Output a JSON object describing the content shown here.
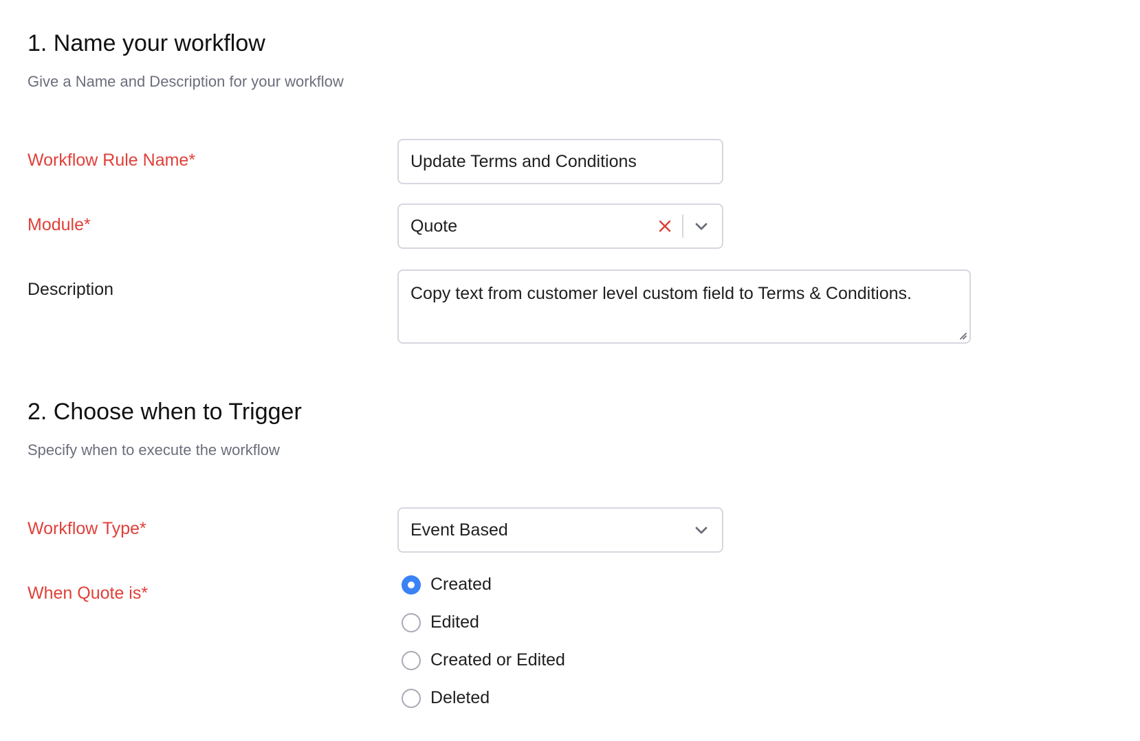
{
  "section1": {
    "title": "1. Name your workflow",
    "subtitle": "Give a Name and Description for your workflow"
  },
  "fields": {
    "rule_name": {
      "label": "Workflow Rule Name*",
      "value": "Update Terms and Conditions"
    },
    "module": {
      "label": "Module*",
      "value": "Quote"
    },
    "description": {
      "label": "Description",
      "value": "Copy text from customer level custom field to Terms & Conditions."
    }
  },
  "section2": {
    "title": "2. Choose when to Trigger",
    "subtitle": "Specify when to execute the workflow"
  },
  "trigger": {
    "workflow_type": {
      "label": "Workflow Type*",
      "value": "Event Based"
    },
    "when": {
      "label": "When Quote is*",
      "options": [
        {
          "label": "Created",
          "selected": true
        },
        {
          "label": "Edited",
          "selected": false
        },
        {
          "label": "Created or Edited",
          "selected": false
        },
        {
          "label": "Deleted",
          "selected": false
        }
      ]
    }
  },
  "colors": {
    "required_label": "#e0403a",
    "radio_selected": "#3b82f6",
    "clear_icon": "#e0403a",
    "border": "#d6d7df",
    "subtitle": "#6b6e7b"
  },
  "icons": {
    "clear": "close-icon",
    "dropdown": "chevron-down-icon",
    "resize": "resize-handle-icon"
  }
}
